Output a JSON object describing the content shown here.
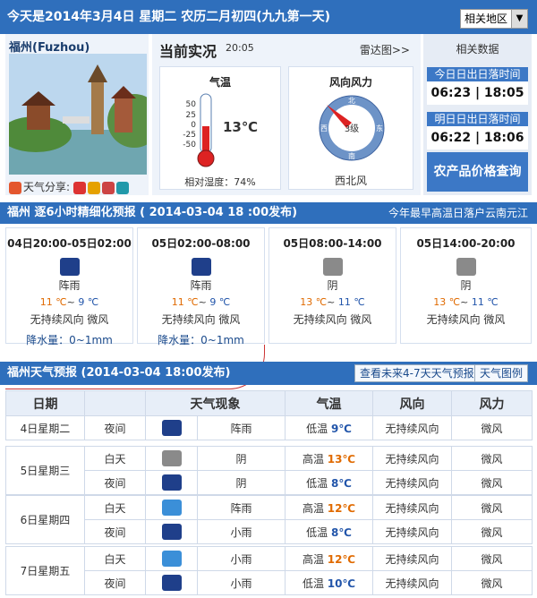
{
  "topbar": {
    "date_text": "今天是2014年3月4日 星期二 农历二月初四(九九第一天)",
    "region_label": "相关地区",
    "region_arrow": "▼"
  },
  "city": {
    "name": "福州(Fuzhou)",
    "share_label": "天气分享:"
  },
  "current": {
    "title": "当前实况",
    "time": "20:05",
    "radar_link": "雷达图>>",
    "temp_title": "气温",
    "temp_value": "13℃",
    "scale": [
      "50",
      "25",
      "0",
      "-25",
      "-50"
    ],
    "humidity": "相对湿度：74%",
    "wind_title": "风向风力",
    "wind_level": "3级",
    "wind_dir": "西北风",
    "compass": {
      "n": "北",
      "s": "南",
      "e": "东",
      "w": "西"
    },
    "wind_level_numeric": 3
  },
  "data": {
    "title": "相关数据",
    "today_label": "今日日出日落时间",
    "today_value": "06:23 | 18:05",
    "tomorrow_label": "明日日出日落时间",
    "tomorrow_value": "06:22 | 18:06",
    "agri_button": "农产品价格查询"
  },
  "hourly_bar": {
    "left": "福州 逐6小时精细化预报 ( 2014-03-04   18 :00发布)",
    "right": "今年最早高温日落户云南元江"
  },
  "hourly": [
    {
      "time": "04日20:00-05日02:00",
      "weather": "阵雨",
      "high": "11 ℃",
      "low": "9 ℃",
      "wind": "无持续风向 微风",
      "rain_label": "降水量：",
      "rain": "0~1mm",
      "icon": "night-shower-icon"
    },
    {
      "time": "05日02:00-08:00",
      "weather": "阵雨",
      "high": "11 ℃",
      "low": "9 ℃",
      "wind": "无持续风向 微风",
      "rain_label": "降水量：",
      "rain": "0~1mm",
      "icon": "night-shower-icon"
    },
    {
      "time": "05日08:00-14:00",
      "weather": "阴",
      "high": "13 ℃",
      "low": "11 ℃",
      "wind": "无持续风向 微风",
      "rain_label": "",
      "rain": "",
      "icon": "overcast-icon"
    },
    {
      "time": "05日14:00-20:00",
      "weather": "阴",
      "high": "13 ℃",
      "low": "11 ℃",
      "wind": "无持续风向 微风",
      "rain_label": "",
      "rain": "",
      "icon": "overcast-icon"
    }
  ],
  "daily_bar": {
    "title": "福州天气预报 (2014-03-04   18:00发布)",
    "btn_more": "查看未来4-7天天气预报",
    "btn_map": "天气图例"
  },
  "daily_headers": [
    "日期",
    "天气现象",
    "气温",
    "风向",
    "风力"
  ],
  "daily": [
    {
      "date": "4日星期二",
      "rows": [
        {
          "period": "夜间",
          "weather": "阵雨",
          "tlabel": "低温",
          "temp": "9℃",
          "wind": "无持续风向",
          "force": "微风",
          "icon": "night"
        }
      ]
    },
    {
      "date": "5日星期三",
      "rows": [
        {
          "period": "白天",
          "weather": "阴",
          "tlabel": "高温",
          "temp": "13℃",
          "wind": "无持续风向",
          "force": "微风",
          "icon": "cloud"
        },
        {
          "period": "夜间",
          "weather": "阴",
          "tlabel": "低温",
          "temp": "8℃",
          "wind": "无持续风向",
          "force": "微风",
          "icon": "night"
        }
      ]
    },
    {
      "date": "6日星期四",
      "rows": [
        {
          "period": "白天",
          "weather": "阵雨",
          "tlabel": "高温",
          "temp": "12℃",
          "wind": "无持续风向",
          "force": "微风",
          "icon": "day"
        },
        {
          "period": "夜间",
          "weather": "小雨",
          "tlabel": "低温",
          "temp": "8℃",
          "wind": "无持续风向",
          "force": "微风",
          "icon": "night"
        }
      ]
    },
    {
      "date": "7日星期五",
      "rows": [
        {
          "period": "白天",
          "weather": "小雨",
          "tlabel": "高温",
          "temp": "12℃",
          "wind": "无持续风向",
          "force": "微风",
          "icon": "day"
        },
        {
          "period": "夜间",
          "weather": "小雨",
          "tlabel": "低温",
          "temp": "10℃",
          "wind": "无持续风向",
          "force": "微风",
          "icon": "night"
        }
      ]
    }
  ]
}
